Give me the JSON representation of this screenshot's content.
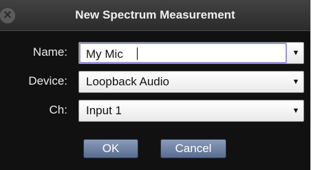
{
  "dialog": {
    "title": "New Spectrum Measurement"
  },
  "form": {
    "name_label": "Name:",
    "name_value": "My Mic",
    "device_label": "Device:",
    "device_value": "Loopback Audio",
    "channel_label": "Ch:",
    "channel_value": "Input 1"
  },
  "buttons": {
    "ok_label": "OK",
    "cancel_label": "Cancel"
  },
  "icons": {
    "close": "close-icon",
    "dropdown": "chevron-down-icon"
  }
}
